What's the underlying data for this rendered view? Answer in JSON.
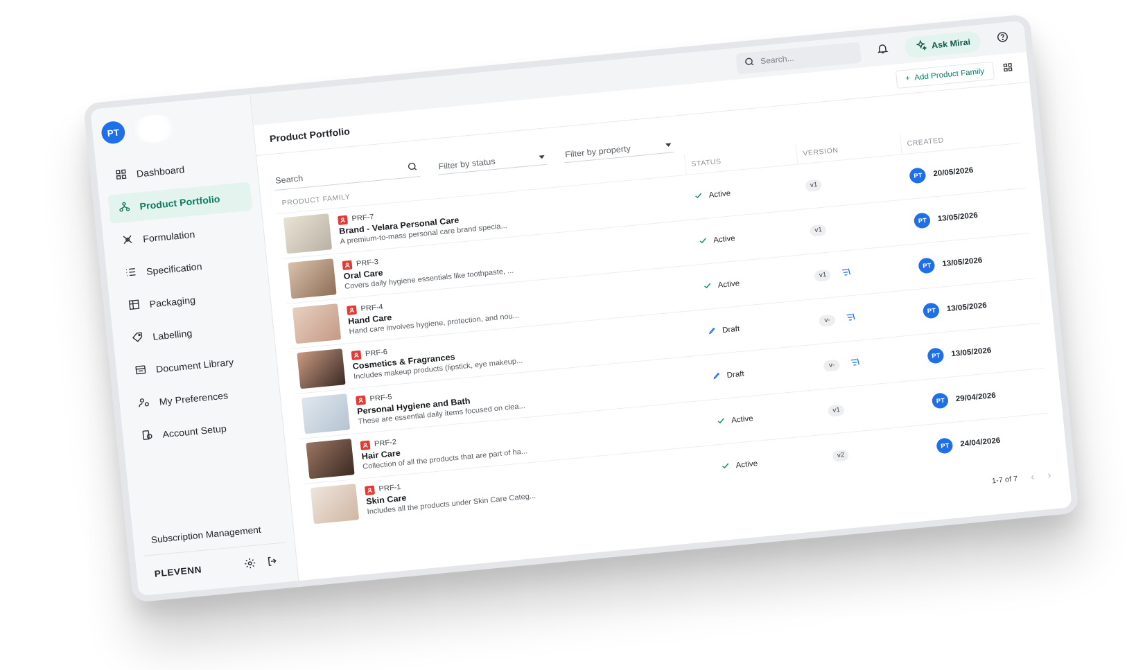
{
  "user": {
    "initials": "PT"
  },
  "sidebar": {
    "items": [
      {
        "label": "Dashboard",
        "icon": "dashboard-icon",
        "active": false
      },
      {
        "label": "Product Portfolio",
        "icon": "portfolio-icon",
        "active": true
      },
      {
        "label": "Formulation",
        "icon": "formulation-icon",
        "active": false
      },
      {
        "label": "Specification",
        "icon": "specification-icon",
        "active": false
      },
      {
        "label": "Packaging",
        "icon": "packaging-icon",
        "active": false
      },
      {
        "label": "Labelling",
        "icon": "label-icon",
        "active": false
      },
      {
        "label": "Document Library",
        "icon": "document-icon",
        "active": false
      },
      {
        "label": "My Preferences",
        "icon": "preferences-icon",
        "active": false
      },
      {
        "label": "Account Setup",
        "icon": "account-icon",
        "active": false
      }
    ],
    "subscription": "Subscription Management",
    "company": "PLEVENN"
  },
  "topbar": {
    "search_placeholder": "Search...",
    "ask_label": "Ask Mirai"
  },
  "page": {
    "title": "Product Portfolio",
    "add_label": "Add Product Family"
  },
  "filters": {
    "search_label": "Search",
    "status_label": "Filter by status",
    "property_label": "Filter by property"
  },
  "table": {
    "headers": {
      "family": "PRODUCT FAMILY",
      "status": "STATUS",
      "version": "VERSION",
      "created": "CREATED"
    },
    "rows": [
      {
        "id": "PRF-7",
        "name": "Brand - Velara Personal Care",
        "desc": "A premium-to-mass personal care brand specia...",
        "status": "Active",
        "version": "v1",
        "created": "20/05/2026",
        "creator": "PT",
        "thumb": [
          "#e9e3d6",
          "#b9b2a4"
        ]
      },
      {
        "id": "PRF-3",
        "name": "Oral Care",
        "desc": "Covers daily hygiene essentials like toothpaste, ...",
        "status": "Active",
        "version": "v1",
        "created": "13/05/2026",
        "creator": "PT",
        "thumb": [
          "#d9c2ae",
          "#8e6e57"
        ]
      },
      {
        "id": "PRF-4",
        "name": "Hand Care",
        "desc": "Hand care involves hygiene, protection, and nou...",
        "status": "Active",
        "version": "v1",
        "created": "13/05/2026",
        "creator": "PT",
        "thumb": [
          "#e8cfc0",
          "#c49a85"
        ]
      },
      {
        "id": "PRF-6",
        "name": "Cosmetics & Fragrances",
        "desc": "Includes makeup products (lipstick, eye makeup...",
        "status": "Draft",
        "version": "v-",
        "created": "13/05/2026",
        "creator": "PT",
        "thumb": [
          "#c99a82",
          "#3a2a24"
        ]
      },
      {
        "id": "PRF-5",
        "name": "Personal Hygiene and Bath",
        "desc": "These are essential daily items focused on clea...",
        "status": "Draft",
        "version": "v-",
        "created": "13/05/2026",
        "creator": "PT",
        "thumb": [
          "#dfe7ee",
          "#b5c4d1"
        ]
      },
      {
        "id": "PRF-2",
        "name": "Hair Care",
        "desc": "Collection of all the products that are part of ha...",
        "status": "Active",
        "version": "v1",
        "created": "29/04/2026",
        "creator": "PT",
        "thumb": [
          "#9a7563",
          "#3b2a22"
        ]
      },
      {
        "id": "PRF-1",
        "name": "Skin Care",
        "desc": "Includes all the products under Skin Care Categ...",
        "status": "Active",
        "version": "v2",
        "created": "24/04/2026",
        "creator": "PT",
        "thumb": [
          "#efe5dc",
          "#cfb6a3"
        ]
      }
    ]
  },
  "pagination": {
    "label": "1-7 of 7"
  },
  "colors": {
    "accent": "#0e7a5f",
    "avatar": "#1e6fe8",
    "active_bg": "#e3f3ee",
    "draft_icon": "#1e6fe8",
    "id_badge": "#e23b36"
  }
}
